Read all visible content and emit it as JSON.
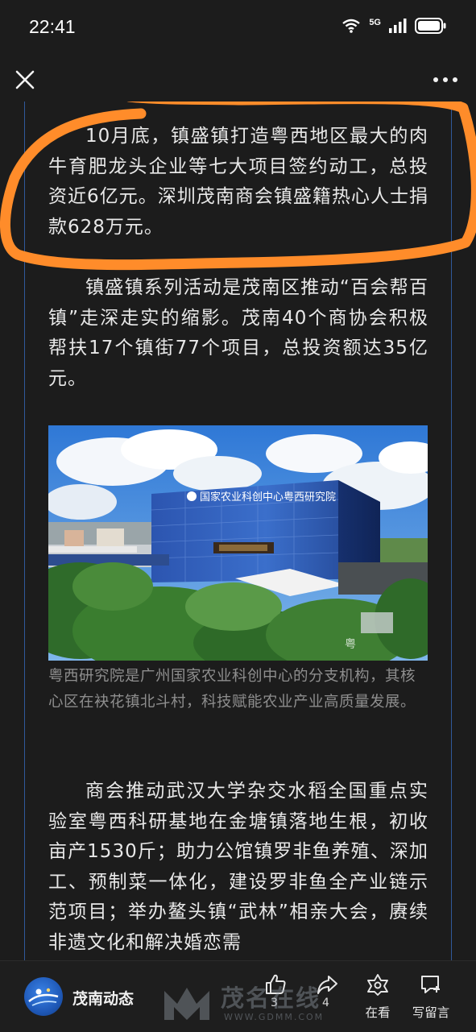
{
  "status_bar": {
    "time": "22:41",
    "network": "5G"
  },
  "article": {
    "paragraphs": [
      "10月底，镇盛镇打造粤西地区最大的肉牛育肥龙头企业等七大项目签约动工，总投资近6亿元。深圳茂南商会镇盛籍热心人士捐款628万元。",
      "镇盛镇系列活动是茂南区推动“百会帮百镇”走深走实的缩影。茂南40个商协会积极帮扶17个镇街77个项目，总投资额达35亿元。",
      "商会推动武汉大学杂交水稻全国重点实验室粤西科研基地在金塘镇落地生根，初收亩产1530斤；助力公馆镇罗非鱼养殖、深加工、预制菜一体化，建设罗非鱼全产业链示范项目；举办鳌头镇“武林”相亲大会，赓续非遗文化和解决婚恋需"
    ],
    "image": {
      "building_sign": "国家农业科创中心粤西研究院",
      "watermark_text": "粤"
    },
    "caption": "粤西研究院是广州国家农业科创中心的分支机构，其核心区在袂花镇北斗村，科技赋能农业产业高质量发展。"
  },
  "bottom_bar": {
    "account_name": "茂南动态",
    "like_count": "3",
    "share_count": "4",
    "view_label": "在看",
    "comment_label": "写留言"
  },
  "watermark": {
    "text": "茂名在线",
    "url": "WWW.GDMM.COM"
  },
  "colors": {
    "background": "#1c1c1c",
    "highlight": "#ff8c2a",
    "accent_rule": "#3c7be0"
  }
}
